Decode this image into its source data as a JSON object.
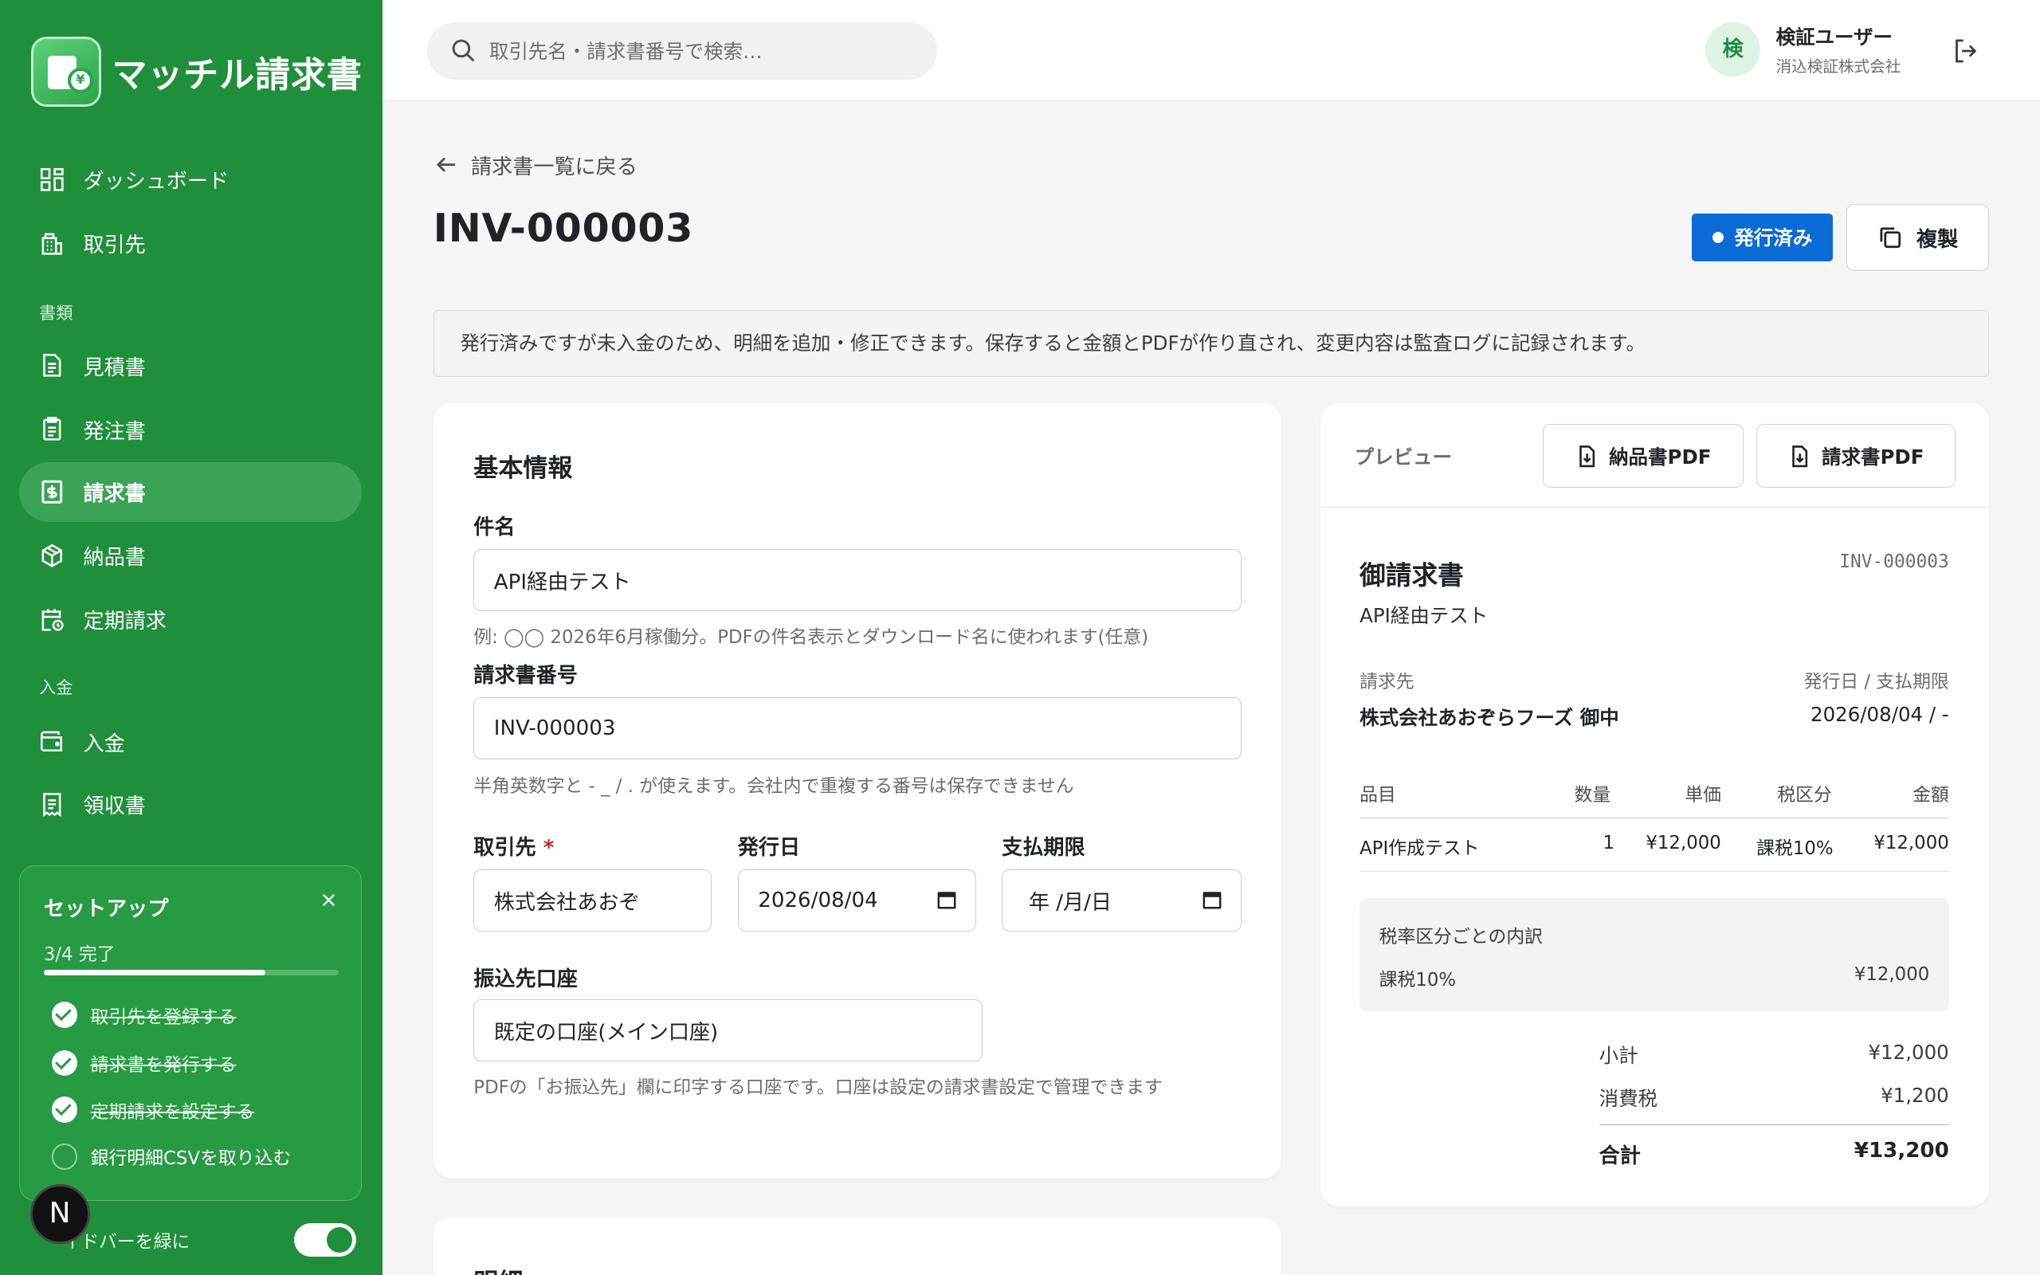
{
  "app": {
    "name": "マッチル請求書"
  },
  "sidebar": {
    "nav": [
      {
        "label": "ダッシュボード"
      },
      {
        "label": "取引先"
      }
    ],
    "section_docs": "書類",
    "docs": [
      {
        "label": "見積書"
      },
      {
        "label": "発注書"
      },
      {
        "label": "請求書"
      },
      {
        "label": "納品書"
      },
      {
        "label": "定期請求"
      }
    ],
    "section_payment": "入金",
    "payment": [
      {
        "label": "入金"
      },
      {
        "label": "領収書"
      }
    ],
    "setup": {
      "title": "セットアップ",
      "count": "3/4 完了",
      "progress": 0.75,
      "tasks": [
        {
          "label": "取引先を登録する",
          "done": true
        },
        {
          "label": "請求書を発行する",
          "done": true
        },
        {
          "label": "定期請求を設定する",
          "done": true
        },
        {
          "label": "銀行明細CSVを取り込む",
          "done": false
        }
      ]
    },
    "toggle_label": "イドバーを緑に",
    "badge": "N"
  },
  "topbar": {
    "search_placeholder": "取引先名・請求書番号で検索…",
    "user": {
      "avatar": "検",
      "name": "検証ユーザー",
      "org": "消込検証株式会社"
    }
  },
  "main": {
    "back_label": "請求書一覧に戻る",
    "title": "INV-000003",
    "status": "発行済み",
    "copy_label": "複製",
    "notice": "発行済みですが未入金のため、明細を追加・修正できます。保存すると金額とPDFが作り直され、変更内容は監査ログに記録されます。"
  },
  "form": {
    "section_title": "基本情報",
    "subject": {
      "label": "件名",
      "value": "API経由テスト",
      "hint": "例: ◯◯ 2026年6月稼働分。PDFの件名表示とダウンロード名に使われます(任意)"
    },
    "number": {
      "label": "請求書番号",
      "value": "INV-000003",
      "hint": "半角英数字と - _ / . が使えます。会社内で重複する番号は保存できません"
    },
    "client": {
      "label": "取引先",
      "required": "*",
      "value": "株式会社あおぞ"
    },
    "issue_date": {
      "label": "発行日",
      "value": "2026/08/04"
    },
    "due_date": {
      "label": "支払期限",
      "value": "年 /月/日"
    },
    "account": {
      "label": "振込先口座",
      "value": "既定の口座(メイン口座)",
      "hint": "PDFの「お振込先」欄に印字する口座です。口座は設定の請求書設定で管理できます"
    },
    "next_section": "明細"
  },
  "preview": {
    "label": "プレビュー",
    "delivery_pdf": "納品書PDF",
    "invoice_pdf": "請求書PDF",
    "doc_title": "御請求書",
    "doc_no": "INV-000003",
    "subject": "API経由テスト",
    "bill_to_label": "請求先",
    "bill_to": "株式会社あおぞらフーズ 御中",
    "dates_label": "発行日 / 支払期限",
    "dates": "2026/08/04 / -",
    "columns": {
      "item": "品目",
      "qty": "数量",
      "price": "単価",
      "tax": "税区分",
      "amount": "金額"
    },
    "rows": [
      {
        "item": "API作成テスト",
        "qty": "1",
        "price": "¥12,000",
        "tax": "課税10%",
        "amount": "¥12,000"
      }
    ],
    "tax_breakdown": {
      "title": "税率区分ごとの内訳",
      "label": "課税10%",
      "value": "¥12,000"
    },
    "subtotal": {
      "label": "小計",
      "value": "¥12,000"
    },
    "tax": {
      "label": "消費税",
      "value": "¥1,200"
    },
    "total": {
      "label": "合計",
      "value": "¥13,200"
    }
  }
}
